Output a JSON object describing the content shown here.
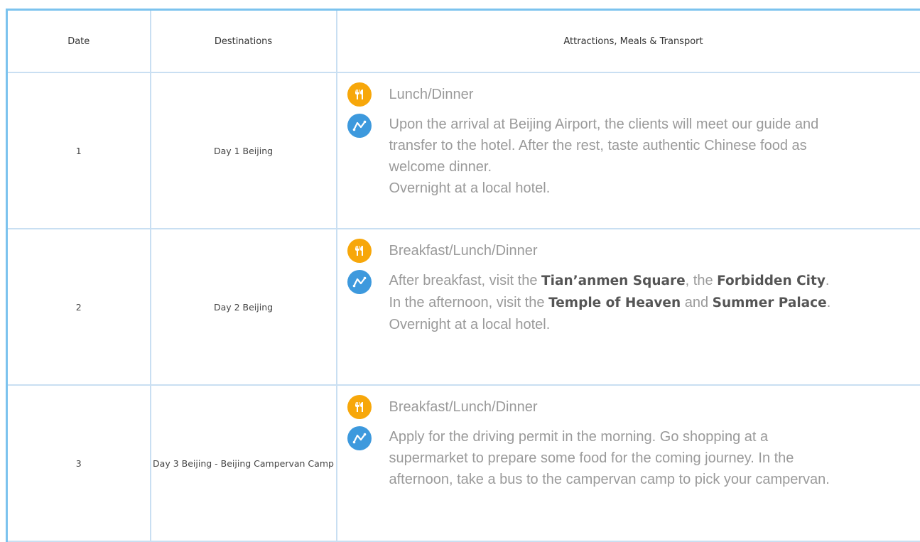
{
  "table": {
    "headers": {
      "date": "Date",
      "destinations": "Destinations",
      "details": "Attractions, Meals & Transport"
    },
    "rows": [
      {
        "date": "1",
        "destination": "Day 1 Beijing",
        "meals": "Lunch/Dinner",
        "itinerary": [
          {
            "text": "Upon the arrival at Beijing Airport, the clients will meet our guide and transfer to the hotel. After the rest, taste authentic Chinese food as welcome dinner."
          }
        ],
        "overnight": "Overnight at a local hotel."
      },
      {
        "date": "2",
        "destination": "Day 2 Beijing",
        "meals": "Breakfast/Lunch/Dinner",
        "itinerary": [
          {
            "t1": "After breakfast, visit the ",
            "b1": "Tian’anmen Square",
            "t2": ", the ",
            "b2": "Forbidden City",
            "t3": ". In the afternoon, visit the ",
            "b3": "Temple of Heaven",
            "t4": "  and ",
            "b4": "Summer Palace",
            "t5": "."
          }
        ],
        "overnight": "Overnight at a local hotel."
      },
      {
        "date": "3",
        "destination": "Day 3 Beijing - Beijing Campervan Camp",
        "meals": "Breakfast/Lunch/Dinner",
        "itinerary": [
          {
            "text": "Apply for the driving permit in the morning. Go shopping at a supermarket to prepare some food for the coming journey. In the afternoon, take a bus to the campervan camp to pick your campervan."
          }
        ]
      }
    ]
  },
  "icons": {
    "meal": "fork-spoon-icon",
    "route": "route-icon"
  },
  "colors": {
    "meal_icon": "#f7a70a",
    "route_icon": "#3d99dd",
    "outer_border": "#7cc3ee",
    "inner_border": "#c9dff2",
    "body_text": "#9a9a9a"
  }
}
